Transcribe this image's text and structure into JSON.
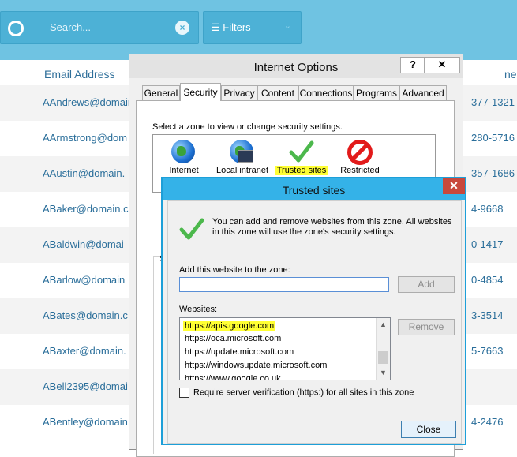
{
  "toolbar": {
    "search_placeholder": "Search...",
    "clear_symbol": "×",
    "filters_label": "☰ Filters",
    "filters_chevron": "⌄"
  },
  "table": {
    "column_email": "Email Address",
    "column_phone_partial": "ne",
    "rows": [
      {
        "email": "AAndrews@domain",
        "phone": "377-1321"
      },
      {
        "email": "AArmstrong@dom",
        "phone": "280-5716"
      },
      {
        "email": "AAustin@domain.",
        "phone": "357-1686"
      },
      {
        "email": "ABaker@domain.c",
        "phone": "4-9668"
      },
      {
        "email": "ABaldwin@domai",
        "phone": "0-1417"
      },
      {
        "email": "ABarlow@domain",
        "phone": "0-4854"
      },
      {
        "email": "ABates@domain.c",
        "phone": "3-3514"
      },
      {
        "email": "ABaxter@domain.",
        "phone": "5-7663"
      },
      {
        "email": "ABell2395@domai",
        "phone": ""
      },
      {
        "email": "ABentley@domain",
        "phone": "4-2476"
      }
    ]
  },
  "internet_options": {
    "title": "Internet Options",
    "help_label": "?",
    "close_label": "✕",
    "tabs": [
      "General",
      "Security",
      "Privacy",
      "Content",
      "Connections",
      "Programs",
      "Advanced"
    ],
    "active_tab": "Security",
    "zone_prompt": "Select a zone to view or change security settings.",
    "zones": [
      "Internet",
      "Local intranet",
      "Trusted sites",
      "Restricted"
    ],
    "partial_letter": "S"
  },
  "trusted_sites": {
    "title": "Trusted sites",
    "close_label": "✕",
    "info": "You can add and remove websites from this zone. All websites in this zone will use the zone's security settings.",
    "add_label": "Add this website to the zone:",
    "add_value": "",
    "add_button": "Add",
    "websites_label": "Websites:",
    "websites": [
      "https://apis.google.com",
      "https://oca.microsoft.com",
      "https://update.microsoft.com",
      "https://windowsupdate.microsoft.com",
      "https://www.google.co.uk"
    ],
    "remove_button": "Remove",
    "require_verification_label": "Require server verification (https:) for all sites in this zone",
    "require_verification_checked": false,
    "close_button": "Close"
  },
  "colors": {
    "topbar": "#6fc3e2",
    "highlight": "#ffff33",
    "link_text": "#2a6e9a",
    "dialog_title": "#34b2e8",
    "close_red": "#c8483c"
  }
}
